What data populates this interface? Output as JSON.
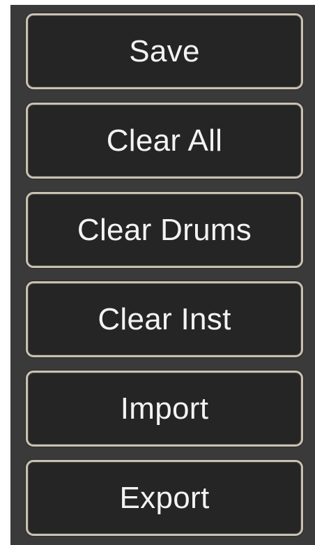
{
  "panel": {
    "buttons": [
      {
        "id": "save",
        "label": "Save"
      },
      {
        "id": "clear-all",
        "label": "Clear All"
      },
      {
        "id": "clear-drums",
        "label": "Clear Drums"
      },
      {
        "id": "clear-inst",
        "label": "Clear Inst"
      },
      {
        "id": "import",
        "label": "Import"
      },
      {
        "id": "export",
        "label": "Export"
      }
    ]
  }
}
